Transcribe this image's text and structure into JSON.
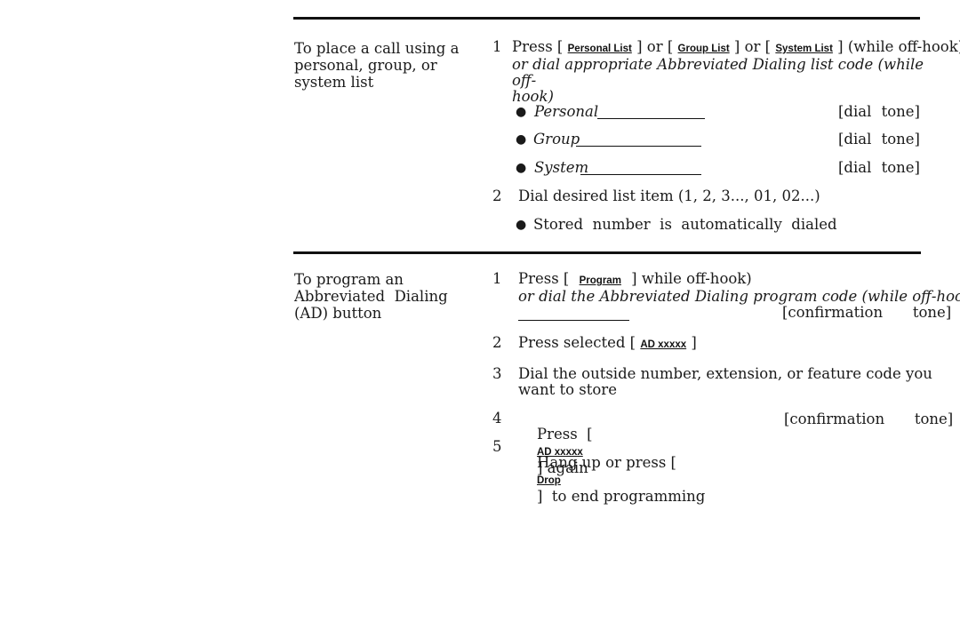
{
  "sections": [
    {
      "title": "To place a call using a personal, group, or system list",
      "title_lines": [
        "To place a call using a",
        "personal, group, or",
        "system list"
      ],
      "steps": [
        {
          "number": "1",
          "text_parts": {
            "press": "Press [",
            "key1": "Personal List",
            "or1": "] or [",
            "key2": "Group List",
            "or2": "] or [",
            "key3": "System List",
            "tail": "]  (while off-hook)"
          },
          "alt_lines": [
            "or dial appropriate Abbreviated Dialing list code (while off-",
            "hook)"
          ],
          "bullets": [
            {
              "label": "Personal",
              "result": "[dial  tone]"
            },
            {
              "label": "Group",
              "result": "[dial  tone]"
            },
            {
              "label": "System",
              "result": "[dial  tone]"
            }
          ]
        },
        {
          "number": "2",
          "text": "Dial desired list item (1, 2, 3..., 01, 02...)",
          "bullets": [
            {
              "label": "Stored  number  is  automatically  dialed"
            }
          ]
        }
      ]
    },
    {
      "title": "To program an Abbreviated Dialing (AD) button",
      "title_lines": [
        "To program an",
        "Abbreviated  Dialing",
        "(AD) button"
      ],
      "steps": [
        {
          "number": "1",
          "press": "Press [",
          "key": "Program",
          "tail": "] while off-hook)",
          "alt_line": "or dial the Abbreviated Dialing program code (while off-hook)",
          "result": "[confirmation   tone]"
        },
        {
          "number": "2",
          "press": "Press selected [",
          "key": "AD xxxxx",
          "tail": "]"
        },
        {
          "number": "3",
          "lines": [
            "Dial the outside number, extension, or feature code you",
            "want to store"
          ]
        },
        {
          "number": "4",
          "press": "Press  [",
          "key": "AD xxxxx",
          "tail": "] again",
          "result": "[confirmation   tone]"
        },
        {
          "number": "5",
          "press": "Hang up or press [",
          "key": "Drop",
          "tail": "]  to end programming"
        }
      ]
    }
  ]
}
